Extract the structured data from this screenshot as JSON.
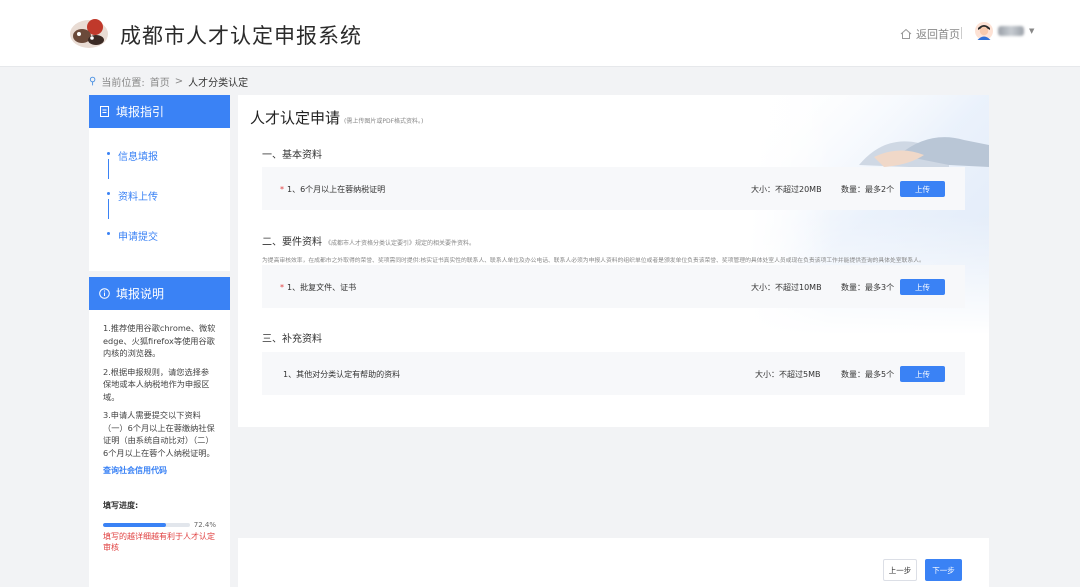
{
  "header": {
    "title": "成都市人才认定申报系统",
    "home_link": "返回首页"
  },
  "breadcrumb": {
    "prefix": "当前位置:",
    "home": "首页",
    "separator": ">",
    "current": "人才分类认定"
  },
  "sidebar": {
    "guide_title": "填报指引",
    "steps": [
      {
        "label": "信息填报"
      },
      {
        "label": "资料上传"
      },
      {
        "label": "申请提交"
      }
    ],
    "notes_title": "填报说明",
    "notes": [
      "1.推荐使用谷歌chrome、微软edge、火狐firefox等使用谷歌内核的浏览器。",
      "2.根据申报规则，请您选择参保地或本人纳税地作为申报区域。",
      "3.申请人需要提交以下资料（一）6个月以上在蓉缴纳社保证明（由系统自动比对）（二）6个月以上在蓉个人纳税证明。"
    ],
    "credit_link": "查询社会信用代码",
    "progress_label": "填写进度:",
    "progress_percent": "72.4%",
    "progress_value": 0.724,
    "progress_hint": "填写的越详细越有利于人才认定审核"
  },
  "main": {
    "title": "人才认定申请",
    "title_note": "(需上传图片或PDF格式资料。)",
    "sections": [
      {
        "title": "一、基本资料",
        "desc": "",
        "items": [
          {
            "required": "*",
            "label": "1、6个月以上在蓉纳税证明",
            "size": "大小：不超过20MB",
            "count": "数量：最多2个",
            "button": "上传"
          }
        ]
      },
      {
        "title": "二、要件资料",
        "title_note": "《成都市人才资格分类认定要引》规定的相关要件资料。",
        "desc": "为提高审核效率，在成都市之外取得的荣誉、奖项需同时提供:核实证书真实性的联系人、联系人单位及办公电话、联系人必须为申报人资料的组织单位或者是颁发单位负责该荣誉、奖项管理的具体处室人员或现在负责该项工作并能提供查询的具体处室联系人。",
        "items": [
          {
            "required": "*",
            "label": "1、批复文件、证书",
            "size": "大小：不超过10MB",
            "count": "数量：最多3个",
            "button": "上传"
          }
        ]
      },
      {
        "title": "三、补充资料",
        "desc": "",
        "items": [
          {
            "required": "",
            "label": "1、其他对分类认定有帮助的资料",
            "size": "大小：不超过5MB",
            "count": "数量：最多5个",
            "button": "上传"
          }
        ]
      }
    ]
  },
  "footer": {
    "prev": "上一步",
    "next": "下一步"
  },
  "colors": {
    "accent": "#3a82f5",
    "required": "#e04040"
  }
}
